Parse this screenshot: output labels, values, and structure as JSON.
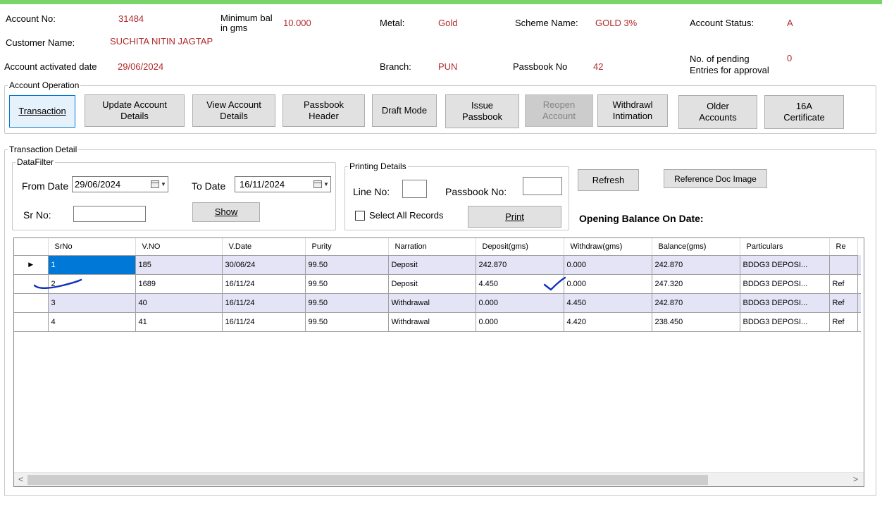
{
  "account": {
    "account_no_label": "Account No:",
    "account_no": "31484",
    "min_bal_label": "Minimum bal\nin gms",
    "min_bal": "10.000",
    "metal_label": "Metal:",
    "metal": "Gold",
    "scheme_label": "Scheme Name:",
    "scheme": "GOLD 3%",
    "status_label": "Account Status:",
    "status": "A",
    "customer_label": "Customer Name:",
    "customer": "SUCHITA NITIN JAGTAP",
    "activated_label": "Account activated date",
    "activated": "29/06/2024",
    "branch_label": "Branch:",
    "branch": "PUN",
    "passbook_label": "Passbook No",
    "passbook": "42",
    "pending_label": "No. of pending\nEntries for approval",
    "pending": "0"
  },
  "operation": {
    "legend": "Account Operation",
    "buttons": {
      "transaction": "Transaction",
      "update": "Update Account\nDetails",
      "view": "View Account\nDetails",
      "passbook_header": "Passbook\nHeader",
      "draft": "Draft Mode",
      "issue": "Issue\nPassbook",
      "reopen": "Reopen\nAccount",
      "withdrawl": "Withdrawl\nIntimation",
      "older": "Older\nAccounts",
      "cert": "16A\nCertificate"
    }
  },
  "transaction_detail": {
    "legend": "Transaction Detail",
    "filter_legend": "DataFilter",
    "from_label": "From Date",
    "from_value": "29/06/2024",
    "to_label": "To Date",
    "to_value": "16/11/2024",
    "srno_label": "Sr No:",
    "srno_value": "",
    "show_label": "Show",
    "printing_legend": "Printing Details",
    "line_label": "Line No:",
    "line_value": "",
    "passbook_no_label": "Passbook No:",
    "passbook_no_value": "",
    "select_all_label": "Select All Records",
    "select_all_checked": false,
    "print_label": "Print",
    "refresh_label": "Refresh",
    "ref_doc_label": "Reference Doc Image",
    "opening_balance_label": "Opening Balance On Date:"
  },
  "grid": {
    "columns": [
      "SrNo",
      "V.NO",
      "V.Date",
      "Purity",
      "Narration",
      "Deposit(gms)",
      "Withdraw(gms)",
      "Balance(gms)",
      "Particulars",
      "Re"
    ],
    "rows": [
      [
        "1",
        "185",
        "30/06/24",
        "99.50",
        "Deposit",
        "242.870",
        "0.000",
        "242.870",
        "BDDG3 DEPOSI...",
        ""
      ],
      [
        "2",
        "1689",
        "16/11/24",
        "99.50",
        "Deposit",
        "4.450",
        "0.000",
        "247.320",
        "BDDG3 DEPOSI...",
        "Ref"
      ],
      [
        "3",
        "40",
        "16/11/24",
        "99.50",
        "Withdrawal",
        "0.000",
        "4.450",
        "242.870",
        "BDDG3 DEPOSI...",
        "Ref"
      ],
      [
        "4",
        "41",
        "16/11/24",
        "99.50",
        "Withdrawal",
        "0.000",
        "4.420",
        "238.450",
        "BDDG3 DEPOSI...",
        "Ref"
      ]
    ],
    "current_row_marker": "▶",
    "scroll_left": "<",
    "scroll_right": ">"
  },
  "colors": {
    "top_bar": "#79d46a",
    "value_text": "#b02a2a",
    "alt_row": "#e4e4f6",
    "selected_cell": "#0078d7",
    "pen_marks": "#1030c0"
  },
  "icons": [
    "calendar-dropdown-icon",
    "row-pointer-icon",
    "scroll-left-icon",
    "scroll-right-icon"
  ]
}
